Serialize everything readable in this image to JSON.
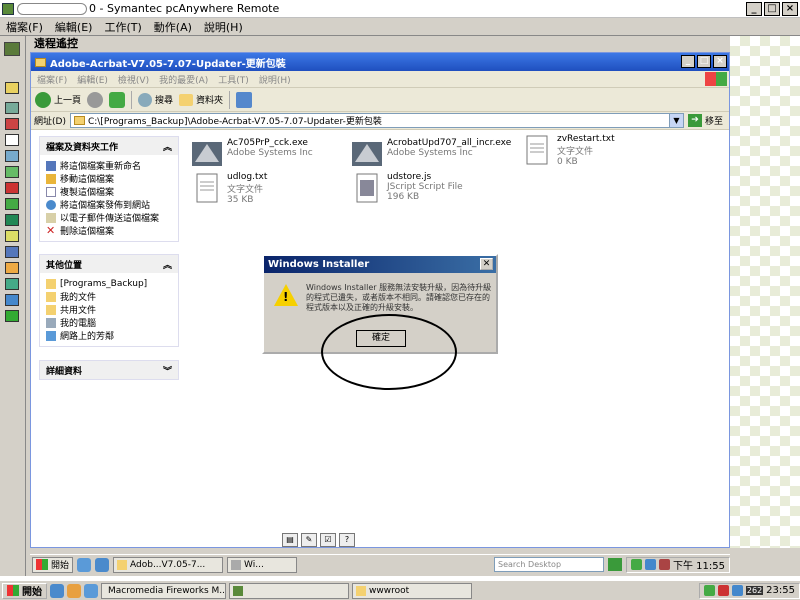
{
  "outer": {
    "title": "0 - Symantec pcAnywhere Remote",
    "menu": [
      "檔案(F)",
      "編輯(E)",
      "工作(T)",
      "動作(A)",
      "說明(H)"
    ],
    "controls": [
      "_",
      "□",
      "×"
    ],
    "remote_header": "遠程遙控"
  },
  "explorer": {
    "title": "Adobe-Acrbat-V7.05-7.07-Updater-更新包裝",
    "menu": [
      "檔案(F)",
      "編輯(E)",
      "檢視(V)",
      "我的最愛(A)",
      "工具(T)",
      "說明(H)"
    ],
    "toolbar": {
      "back": "上一頁",
      "search": "搜尋",
      "folders": "資料夾"
    },
    "address_label": "網址(D)",
    "address_value": "C:\\[Programs_Backup]\\Adobe-Acrbat-V7.05-7.07-Updater-更新包裝",
    "go_label": "移至"
  },
  "tasks": {
    "file_tasks_header": "檔案及資料夾工作",
    "file_tasks": [
      "將這個檔案重新命名",
      "移動這個檔案",
      "複製這個檔案",
      "將這個檔案發佈到網站",
      "以電子郵件傳送這個檔案",
      "刪除這個檔案"
    ],
    "other_places_header": "其他位置",
    "other_places": [
      "[Programs_Backup]",
      "我的文件",
      "共用文件",
      "我的電腦",
      "網路上的芳鄰"
    ],
    "details_header": "詳細資料"
  },
  "files": [
    {
      "name": "Ac705PrP_cck.exe",
      "meta1": "Adobe Systems Inc",
      "meta2": ""
    },
    {
      "name": "AcrobatUpd707_all_incr.exe",
      "meta1": "Adobe Systems Inc",
      "meta2": ""
    },
    {
      "name": "zvRestart.txt",
      "meta1": "文字文件",
      "meta2": "0 KB"
    },
    {
      "name": "udlog.txt",
      "meta1": "文字文件",
      "meta2": "35 KB"
    },
    {
      "name": "udstore.js",
      "meta1": "JScript Script File",
      "meta2": "196 KB"
    }
  ],
  "dialog": {
    "title": "Windows Installer",
    "message": "Windows Installer 服務無法安裝升級，因為待升級的程式已遺失，或者版本不相同。請確認您已存在的程式版本以及正確的升級安裝。",
    "ok": "確定"
  },
  "remote_taskbar": {
    "start": "開始",
    "task1": "Adob...V7.05-7...",
    "task2": "Wi...",
    "search_placeholder": "Search Desktop",
    "clock": "下午 11:55"
  },
  "local_taskbar": {
    "start": "開始",
    "task1": "Macromedia Fireworks M...",
    "task3": "wwwroot",
    "clock": "23:55",
    "tray_badge": "262"
  }
}
